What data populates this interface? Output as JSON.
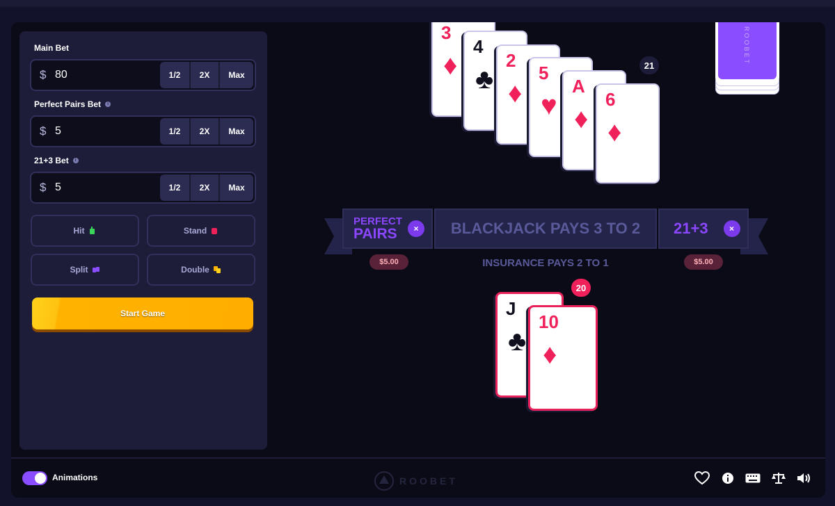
{
  "bets": {
    "main": {
      "label": "Main Bet",
      "currency": "$",
      "value": "80"
    },
    "perfect_pairs": {
      "label": "Perfect Pairs Bet",
      "currency": "$",
      "value": "5"
    },
    "twentyone_plus_three": {
      "label": "21+3 Bet",
      "currency": "$",
      "value": "5"
    },
    "half_label": "1/2",
    "double_label": "2X",
    "max_label": "Max"
  },
  "actions": {
    "hit": "Hit",
    "stand": "Stand",
    "split": "Split",
    "double": "Double",
    "start": "Start Game"
  },
  "dealer": {
    "total": "21",
    "cards": [
      {
        "rank": "3",
        "suit": "♦",
        "color": "red"
      },
      {
        "rank": "4",
        "suit": "♣",
        "color": "black"
      },
      {
        "rank": "2",
        "suit": "♦",
        "color": "red"
      },
      {
        "rank": "5",
        "suit": "♥",
        "color": "red"
      },
      {
        "rank": "A",
        "suit": "♦",
        "color": "red"
      },
      {
        "rank": "6",
        "suit": "♦",
        "color": "red"
      }
    ]
  },
  "deck": {
    "logo": "ROOBET"
  },
  "player": {
    "total": "20",
    "cards": [
      {
        "rank": "J",
        "suit": "♣",
        "color": "black"
      },
      {
        "rank": "10",
        "suit": "♦",
        "color": "red"
      }
    ]
  },
  "table": {
    "perfect_pairs_line1": "PERFECT",
    "perfect_pairs_line2": "PAIRS",
    "blackjack_pays": "BLACKJACK PAYS 3 TO 2",
    "twentyone_plus_three": "21+3",
    "insurance": "INSURANCE PAYS 2 TO 1",
    "perfect_pairs_amount": "$5.00",
    "twentyone_plus_three_amount": "$5.00",
    "close_symbol": "×"
  },
  "footer": {
    "animations_label": "Animations",
    "animations_on": true,
    "logo": "ROOBET"
  },
  "colors": {
    "accent": "#8a4dff",
    "card_red": "#f0215a",
    "start_button": "#ffb200"
  }
}
